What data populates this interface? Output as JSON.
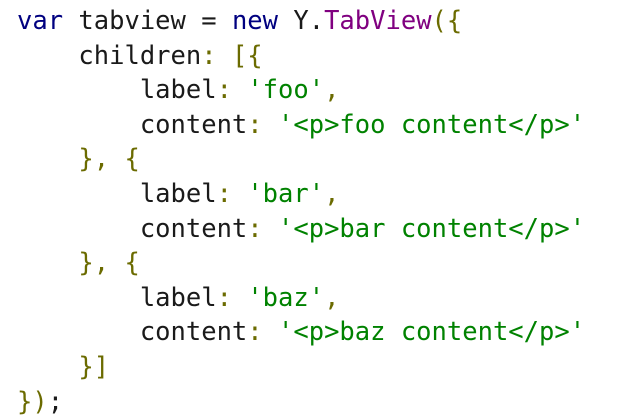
{
  "code": {
    "lines": [
      [
        {
          "t": "var",
          "c": "kw"
        },
        {
          "t": " tabview = ",
          "c": "plain"
        },
        {
          "t": "new",
          "c": "kw"
        },
        {
          "t": " Y.",
          "c": "plain"
        },
        {
          "t": "TabView",
          "c": "cls"
        },
        {
          "t": "({",
          "c": "pun"
        }
      ],
      [
        {
          "t": "    children",
          "c": "plain"
        },
        {
          "t": ": [{",
          "c": "pun"
        }
      ],
      [
        {
          "t": "        label",
          "c": "plain"
        },
        {
          "t": ": ",
          "c": "pun"
        },
        {
          "t": "'foo'",
          "c": "str"
        },
        {
          "t": ",",
          "c": "pun"
        }
      ],
      [
        {
          "t": "        content",
          "c": "plain"
        },
        {
          "t": ": ",
          "c": "pun"
        },
        {
          "t": "'<p>foo content</p>'",
          "c": "str"
        }
      ],
      [
        {
          "t": "    }, {",
          "c": "pun"
        }
      ],
      [
        {
          "t": "        label",
          "c": "plain"
        },
        {
          "t": ": ",
          "c": "pun"
        },
        {
          "t": "'bar'",
          "c": "str"
        },
        {
          "t": ",",
          "c": "pun"
        }
      ],
      [
        {
          "t": "        content",
          "c": "plain"
        },
        {
          "t": ": ",
          "c": "pun"
        },
        {
          "t": "'<p>bar content</p>'",
          "c": "str"
        }
      ],
      [
        {
          "t": "    }, {",
          "c": "pun"
        }
      ],
      [
        {
          "t": "        label",
          "c": "plain"
        },
        {
          "t": ": ",
          "c": "pun"
        },
        {
          "t": "'baz'",
          "c": "str"
        },
        {
          "t": ",",
          "c": "pun"
        }
      ],
      [
        {
          "t": "        content",
          "c": "plain"
        },
        {
          "t": ": ",
          "c": "pun"
        },
        {
          "t": "'<p>baz content</p>'",
          "c": "str"
        }
      ],
      [
        {
          "t": "    }]",
          "c": "pun"
        }
      ],
      [
        {
          "t": "})",
          "c": "pun"
        },
        {
          "t": ";",
          "c": "plain"
        }
      ]
    ]
  },
  "colors": {
    "background": "#ffffff",
    "keyword": "#000080",
    "class_name": "#800080",
    "string": "#008200",
    "punctuation": "#6b6b00",
    "plain": "#1a1a1a"
  }
}
